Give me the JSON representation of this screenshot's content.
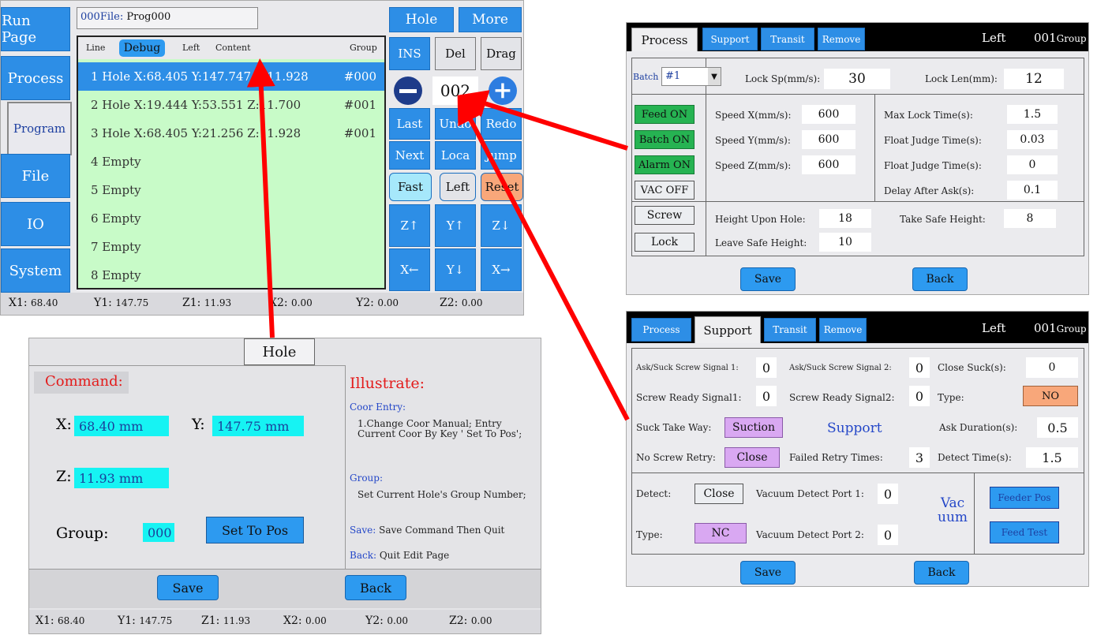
{
  "program_screen": {
    "sidebar": [
      "Run Page",
      "Process",
      "Program",
      "File",
      "IO",
      "System"
    ],
    "file_label": "000File:",
    "file_name": "Prog000",
    "list_header": {
      "line": "Line",
      "debug": "Debug",
      "left": "Left",
      "content": "Content",
      "group": "Group"
    },
    "rows": [
      {
        "text": "1 Hole X:68.405 Y:147.747 Z:11.928",
        "group": "#000"
      },
      {
        "text": "2 Hole X:19.444 Y:53.551 Z:11.700",
        "group": "#001"
      },
      {
        "text": "3 Hole X:68.405 Y:21.256 Z:11.928",
        "group": "#001"
      },
      {
        "text": "4 Empty",
        "group": ""
      },
      {
        "text": "5 Empty",
        "group": ""
      },
      {
        "text": "6 Empty",
        "group": ""
      },
      {
        "text": "7 Empty",
        "group": ""
      },
      {
        "text": "8 Empty",
        "group": ""
      }
    ],
    "buttons": {
      "hole": "Hole",
      "more": "More",
      "ins": "INS",
      "del": "Del",
      "drag": "Drag",
      "counter": "002",
      "last": "Last",
      "undo": "Undo",
      "redo": "Redo",
      "next": "Next",
      "loca": "Loca",
      "jump": "Jump",
      "fast": "Fast",
      "left": "Left",
      "reset": "Reset",
      "z_up": "Z↑",
      "y_up": "Y↑",
      "z_down": "Z↓",
      "x_left": "X←",
      "y_down": "Y↓",
      "x_right": "X→"
    },
    "status": [
      [
        "X1:",
        "68.40"
      ],
      [
        "Y1:",
        "147.75"
      ],
      [
        "Z1:",
        "11.93"
      ],
      [
        "X2:",
        "0.00"
      ],
      [
        "Y2:",
        "0.00"
      ],
      [
        "Z2:",
        "0.00"
      ]
    ]
  },
  "hole_screen": {
    "title": "Hole",
    "command_label": "Command:",
    "illustrate_label": "Illustrate:",
    "x_label": "X:",
    "x_value": "68.40 mm",
    "y_label": "Y:",
    "y_value": "147.75 mm",
    "z_label": "Z:",
    "z_value": "11.93 mm",
    "group_label": "Group:",
    "group_value": "000",
    "set_to_pos": "Set To Pos",
    "coor_entry_title": "Coor Entry:",
    "coor_entry_text": "1.Change Coor Manual; Entry Current Coor By Key ' Set To Pos';",
    "group_title": "Group:",
    "group_text": "Set Current Hole's Group Number;",
    "save_key": "Save:",
    "save_text": "Save Command Then Quit",
    "back_key": "Back:",
    "back_text": "Quit Edit Page",
    "save": "Save",
    "back": "Back",
    "status": [
      [
        "X1:",
        "68.40"
      ],
      [
        "Y1:",
        "147.75"
      ],
      [
        "Z1:",
        "11.93"
      ],
      [
        "X2:",
        "0.00"
      ],
      [
        "Y2:",
        "0.00"
      ],
      [
        "Z2:",
        "0.00"
      ]
    ]
  },
  "process_screen": {
    "tabs": [
      "Process",
      "Support",
      "Transit",
      "Remove"
    ],
    "header_left": "Left",
    "header_group_num": "001",
    "header_group_word": "Group",
    "batch_label": "Batch",
    "batch_value": "#1",
    "lock_sp_label": "Lock Sp(mm/s):",
    "lock_sp_value": "30",
    "lock_len_label": "Lock Len(mm):",
    "lock_len_value": "12",
    "toggles": [
      "Feed ON",
      "Batch ON",
      "Alarm ON",
      "VAC OFF"
    ],
    "screw": "Screw",
    "lock": "Lock",
    "speed_x_label": "Speed X(mm/s):",
    "speed_x": "600",
    "speed_y_label": "Speed Y(mm/s):",
    "speed_y": "600",
    "speed_z_label": "Speed Z(mm/s):",
    "speed_z": "600",
    "max_lock_label": "Max Lock Time(s):",
    "max_lock": "1.5",
    "float1_label": "Float Judge Time(s):",
    "float1": "0.03",
    "float2_label": "Float Judge Time(s):",
    "float2": "0",
    "delay_label": "Delay After Ask(s):",
    "delay": "0.1",
    "height_upon_label": "Height Upon Hole:",
    "height_upon": "18",
    "take_safe_label": "Take Safe Height:",
    "take_safe": "8",
    "leave_safe_label": "Leave Safe Height:",
    "leave_safe": "10",
    "save": "Save",
    "back": "Back"
  },
  "support_screen": {
    "tabs": [
      "Process",
      "Support",
      "Transit",
      "Remove"
    ],
    "header_left": "Left",
    "header_group_num": "001",
    "header_group_word": "Group",
    "ask1_label": "Ask/Suck Screw Signal 1:",
    "ask1": "0",
    "ask2_label": "Ask/Suck Screw Signal 2:",
    "ask2": "0",
    "close_suck_label": "Close Suck(s):",
    "close_suck": "0",
    "ready1_label": "Screw Ready Signal1:",
    "ready1": "0",
    "ready2_label": "Screw Ready Signal2:",
    "ready2": "0",
    "type_label": "Type:",
    "type_value": "NO",
    "suck_way_label": "Suck Take Way:",
    "suck_way": "Suction",
    "support_word": "Support",
    "ask_dur_label": "Ask Duration(s):",
    "ask_dur": "0.5",
    "retry_label": "No Screw Retry:",
    "retry": "Close",
    "failed_label": "Failed Retry Times:",
    "failed": "3",
    "detect_time_label": "Detect Time(s):",
    "detect_time": "1.5",
    "detect_label": "Detect:",
    "detect": "Close",
    "vac1_label": "Vacuum Detect Port 1:",
    "vac1": "0",
    "vac2_label": "Vacuum Detect Port 2:",
    "vac2": "0",
    "type2_label": "Type:",
    "type2": "NC",
    "vac_word_1": "Vac",
    "vac_word_2": "uum",
    "feeder_pos": "Feeder Pos",
    "feed_test": "Feed Test",
    "save": "Save",
    "back": "Back"
  },
  "colors": {
    "button_blue": "#2d8ee6",
    "list_green": "#c8fbc8",
    "highlight": "#2d8ee6",
    "arrow_red": "#ff0000",
    "toggle_green": "#26b352",
    "cyan": "#16f3f3",
    "purple": "#d9a8f2",
    "orange": "#f8a77a"
  }
}
